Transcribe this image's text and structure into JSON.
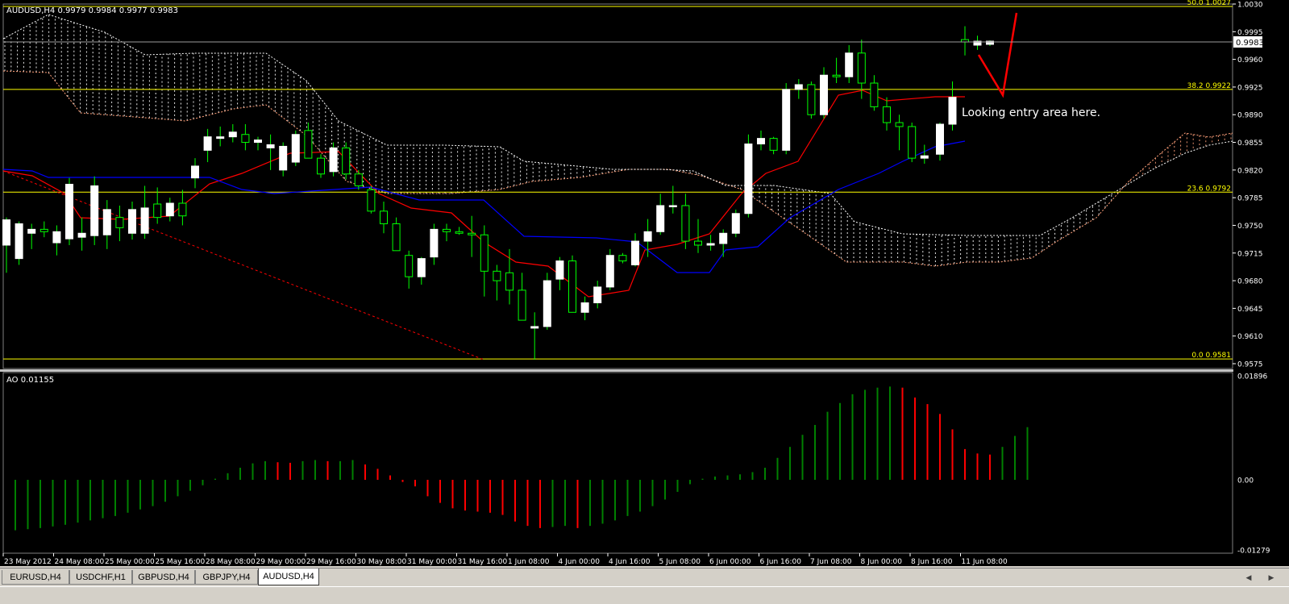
{
  "main_chart": {
    "header": "AUDUSD,H4  0.9979 0.9984 0.9977 0.9983",
    "price_labels": [
      "1.0030",
      "0.9995",
      "0.9960",
      "0.9925",
      "0.9890",
      "0.9855",
      "0.9820",
      "0.9785",
      "0.9750",
      "0.9715",
      "0.9680",
      "0.9645",
      "0.9610",
      "0.9575"
    ],
    "current_price": "0.9983",
    "fib_levels": [
      {
        "label": "50.0 1.0027",
        "price": 1.0027
      },
      {
        "label": "38.2 0.9922",
        "price": 0.9922
      },
      {
        "label": "23.6 0.9792",
        "price": 0.9792
      },
      {
        "label": "0.0 0.9581",
        "price": 0.9581
      }
    ],
    "annotation": "Looking entry area here."
  },
  "ao_panel": {
    "header": "AO 0.01155",
    "labels": [
      "0.01896",
      "0.00",
      "-0.01279"
    ]
  },
  "time_labels": [
    "23 May 2012",
    "24 May 08:00",
    "25 May 00:00",
    "25 May 16:00",
    "28 May 08:00",
    "29 May 00:00",
    "29 May 16:00",
    "30 May 08:00",
    "31 May 00:00",
    "31 May 16:00",
    "1 Jun 08:00",
    "4 Jun 00:00",
    "4 Jun 16:00",
    "5 Jun 08:00",
    "6 Jun 00:00",
    "6 Jun 16:00",
    "7 Jun 08:00",
    "8 Jun 00:00",
    "8 Jun 16:00",
    "11 Jun 08:00"
  ],
  "tabs": [
    "EURUSD,H4",
    "USDCHF,H1",
    "GBPUSD,H4",
    "GBPJPY,H4",
    "AUDUSD,H4"
  ],
  "active_tab": "AUDUSD,H4",
  "colors": {
    "background": "#000000",
    "bull": "#ffffff",
    "bear": "#000000",
    "wick": "#00ff00",
    "fib": "#ffff00",
    "tenkan": "#ff0000",
    "kijun": "#0000ff",
    "cloud_a": "#ffa07a",
    "cloud_b": "#ffffff",
    "ao_up": "#008000",
    "ao_down": "#ff0000",
    "annotation_arrow": "#ff0000"
  },
  "chart_data": {
    "type": "candlestick",
    "symbol": "AUDUSD",
    "timeframe": "H4",
    "ylim": [
      0.957,
      1.003
    ],
    "ohlc": [
      [
        0.9725,
        0.976,
        0.969,
        0.9757
      ],
      [
        0.9708,
        0.9755,
        0.97,
        0.9752
      ],
      [
        0.974,
        0.9752,
        0.972,
        0.9745
      ],
      [
        0.9745,
        0.9755,
        0.9735,
        0.9742
      ],
      [
        0.9728,
        0.975,
        0.9712,
        0.9742
      ],
      [
        0.9733,
        0.981,
        0.9725,
        0.9802
      ],
      [
        0.9735,
        0.976,
        0.9718,
        0.974
      ],
      [
        0.9737,
        0.9812,
        0.9725,
        0.98
      ],
      [
        0.9738,
        0.9782,
        0.972,
        0.977
      ],
      [
        0.976,
        0.9775,
        0.973,
        0.9747
      ],
      [
        0.974,
        0.978,
        0.9732,
        0.977
      ],
      [
        0.974,
        0.98,
        0.9733,
        0.9772
      ],
      [
        0.9777,
        0.9798,
        0.9752,
        0.976
      ],
      [
        0.9762,
        0.9785,
        0.9755,
        0.9778
      ],
      [
        0.9778,
        0.9795,
        0.975,
        0.9762
      ],
      [
        0.981,
        0.9835,
        0.9797,
        0.9825
      ],
      [
        0.9845,
        0.9872,
        0.983,
        0.9862
      ],
      [
        0.986,
        0.9875,
        0.985,
        0.9862
      ],
      [
        0.9862,
        0.9878,
        0.9855,
        0.9868
      ],
      [
        0.9865,
        0.9878,
        0.9845,
        0.9855
      ],
      [
        0.9855,
        0.9862,
        0.9845,
        0.9858
      ],
      [
        0.9848,
        0.9865,
        0.982,
        0.9852
      ],
      [
        0.982,
        0.9855,
        0.9812,
        0.985
      ],
      [
        0.983,
        0.987,
        0.9825,
        0.9865
      ],
      [
        0.987,
        0.988,
        0.9835,
        0.9835
      ],
      [
        0.9835,
        0.984,
        0.981,
        0.9815
      ],
      [
        0.9818,
        0.9855,
        0.9812,
        0.9848
      ],
      [
        0.9848,
        0.9855,
        0.9808,
        0.9815
      ],
      [
        0.9815,
        0.982,
        0.9795,
        0.98
      ],
      [
        0.9795,
        0.98,
        0.9765,
        0.9768
      ],
      [
        0.9768,
        0.978,
        0.974,
        0.9752
      ],
      [
        0.9752,
        0.976,
        0.972,
        0.9718
      ],
      [
        0.9712,
        0.9718,
        0.967,
        0.9685
      ],
      [
        0.9685,
        0.971,
        0.9675,
        0.9708
      ],
      [
        0.971,
        0.9752,
        0.97,
        0.9745
      ],
      [
        0.9745,
        0.9752,
        0.973,
        0.9742
      ],
      [
        0.9742,
        0.9748,
        0.9738,
        0.974
      ],
      [
        0.974,
        0.9762,
        0.971,
        0.9738
      ],
      [
        0.9738,
        0.975,
        0.966,
        0.9692
      ],
      [
        0.9692,
        0.97,
        0.9655,
        0.968
      ],
      [
        0.969,
        0.972,
        0.965,
        0.9668
      ],
      [
        0.9668,
        0.969,
        0.964,
        0.963
      ],
      [
        0.962,
        0.964,
        0.958,
        0.9622
      ],
      [
        0.9622,
        0.969,
        0.9618,
        0.968
      ],
      [
        0.9682,
        0.971,
        0.9668,
        0.9705
      ],
      [
        0.9705,
        0.9712,
        0.964,
        0.964
      ],
      [
        0.964,
        0.966,
        0.963,
        0.9652
      ],
      [
        0.9652,
        0.968,
        0.9645,
        0.9672
      ],
      [
        0.9672,
        0.972,
        0.9668,
        0.9712
      ],
      [
        0.9712,
        0.9715,
        0.9702,
        0.9705
      ],
      [
        0.97,
        0.974,
        0.9698,
        0.973
      ],
      [
        0.973,
        0.9758,
        0.971,
        0.9742
      ],
      [
        0.9742,
        0.979,
        0.9738,
        0.9775
      ],
      [
        0.9775,
        0.98,
        0.9765,
        0.9775
      ],
      [
        0.9775,
        0.979,
        0.972,
        0.973
      ],
      [
        0.973,
        0.9758,
        0.9715,
        0.9725
      ],
      [
        0.9725,
        0.9738,
        0.9718,
        0.9727
      ],
      [
        0.9727,
        0.9745,
        0.971,
        0.974
      ],
      [
        0.974,
        0.977,
        0.9735,
        0.9765
      ],
      [
        0.9765,
        0.9865,
        0.976,
        0.9853
      ],
      [
        0.9853,
        0.987,
        0.9845,
        0.986
      ],
      [
        0.986,
        0.9862,
        0.984,
        0.9845
      ],
      [
        0.9845,
        0.993,
        0.984,
        0.9922
      ],
      [
        0.9922,
        0.9935,
        0.991,
        0.9928
      ],
      [
        0.9928,
        0.9932,
        0.9885,
        0.989
      ],
      [
        0.989,
        0.995,
        0.9885,
        0.994
      ],
      [
        0.994,
        0.9962,
        0.993,
        0.9938
      ],
      [
        0.9938,
        0.9978,
        0.993,
        0.9968
      ],
      [
        0.9968,
        0.9985,
        0.991,
        0.993
      ],
      [
        0.993,
        0.994,
        0.9895,
        0.99
      ],
      [
        0.99,
        0.9912,
        0.987,
        0.988
      ],
      [
        0.988,
        0.989,
        0.9845,
        0.9875
      ],
      [
        0.9875,
        0.988,
        0.983,
        0.9835
      ],
      [
        0.9835,
        0.9852,
        0.9828,
        0.9838
      ],
      [
        0.984,
        0.988,
        0.9832,
        0.9878
      ],
      [
        0.9878,
        0.9932,
        0.987,
        0.9912
      ],
      [
        0.9985,
        1.0002,
        0.9965,
        0.9982
      ],
      [
        0.9978,
        0.999,
        0.9972,
        0.9983
      ],
      [
        0.9979,
        0.9984,
        0.9977,
        0.9983
      ]
    ],
    "ao": [
      -0.0092,
      -0.009,
      -0.0088,
      -0.0085,
      -0.0082,
      -0.0078,
      -0.0074,
      -0.007,
      -0.0066,
      -0.006,
      -0.0054,
      -0.0048,
      -0.004,
      -0.003,
      -0.002,
      -0.001,
      0.0002,
      0.0012,
      0.0022,
      0.003,
      0.0034,
      0.0032,
      0.0031,
      0.0034,
      0.0036,
      0.0034,
      0.0034,
      0.0036,
      0.0028,
      0.002,
      0.0008,
      -0.0004,
      -0.0012,
      -0.003,
      -0.0042,
      -0.0052,
      -0.0056,
      -0.0058,
      -0.006,
      -0.0064,
      -0.0076,
      -0.0084,
      -0.0088,
      -0.0086,
      -0.0084,
      -0.0088,
      -0.0084,
      -0.008,
      -0.0074,
      -0.0066,
      -0.0058,
      -0.0048,
      -0.0036,
      -0.0022,
      -0.0008,
      0.0002,
      0.0006,
      0.0008,
      0.001,
      0.0014,
      0.0022,
      0.004,
      0.006,
      0.0082,
      0.01,
      0.0124,
      0.014,
      0.0156,
      0.0164,
      0.0168,
      0.017,
      0.0168,
      0.015,
      0.0138,
      0.012,
      0.0092,
      0.0056,
      0.0048,
      0.0046,
      0.006,
      0.008,
      0.0096
    ],
    "ao_ylim": [
      -0.01279,
      0.01896
    ]
  }
}
